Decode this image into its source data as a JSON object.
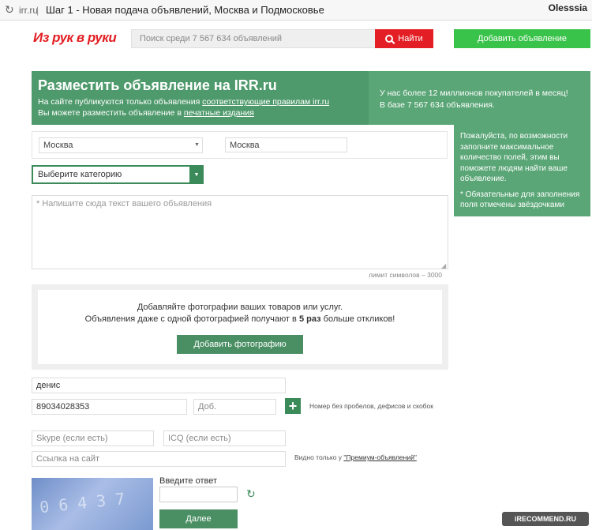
{
  "browser": {
    "url": "irr.ru",
    "separator": "|",
    "title": "Шаг 1 - Новая подача объявлений, Москва и Подмосковье",
    "user": "Olesssia"
  },
  "header": {
    "logo": "Из рук в руки",
    "search_placeholder": "Поиск среди 7 567 634 объявлений",
    "search_button": "Найти",
    "add_button": "Добавить объявление"
  },
  "banner": {
    "title": "Разместить объявление на IRR.ru",
    "line1_prefix": "На сайте публикуются только объявления ",
    "line1_link": "соответствующие правилам irr.ru",
    "line2_prefix": "Вы можете разместить объявление в ",
    "line2_link": "печатные издания",
    "right_line1": "У нас более 12 миллионов покупателей в месяц!",
    "right_line2": "В базе 7 567 634 объявления."
  },
  "hint": {
    "text1": "Пожалуйста, по возможности заполните максимальное количество полей, этим вы поможете людям найти ваше объявление.",
    "text2": "* Обязательные для заполнения поля отмечены звёздочками"
  },
  "location": {
    "region": "Москва",
    "city": "Москва"
  },
  "category": {
    "placeholder": "Выберите категорию"
  },
  "description": {
    "placeholder": "* Напишите сюда текст вашего объявления",
    "limit": "лимит символов – 3000"
  },
  "photos": {
    "line1": "Добавляйте фотографии ваших товаров или услуг.",
    "line2_prefix": "Объявления даже с одной фотографией получают в ",
    "line2_bold": "5 раз",
    "line2_suffix": " больше откликов!",
    "button": "Добавить фотографию"
  },
  "contacts": {
    "name": "денис",
    "phone": "89034028353",
    "ext_placeholder": "Доб.",
    "phone_note": "Номер без пробелов, дефисов и скобок",
    "skype_placeholder": "Skype (если есть)",
    "icq_placeholder": "ICQ (если есть)",
    "site_placeholder": "Ссылка на сайт",
    "site_note_prefix": "Видно только у ",
    "site_note_link": "\"Премиум-объявлений\""
  },
  "captcha": {
    "image_text": "06437",
    "label": "Введите ответ",
    "next_button": "Далее"
  },
  "watermark": "iRECOMMEND.RU"
}
